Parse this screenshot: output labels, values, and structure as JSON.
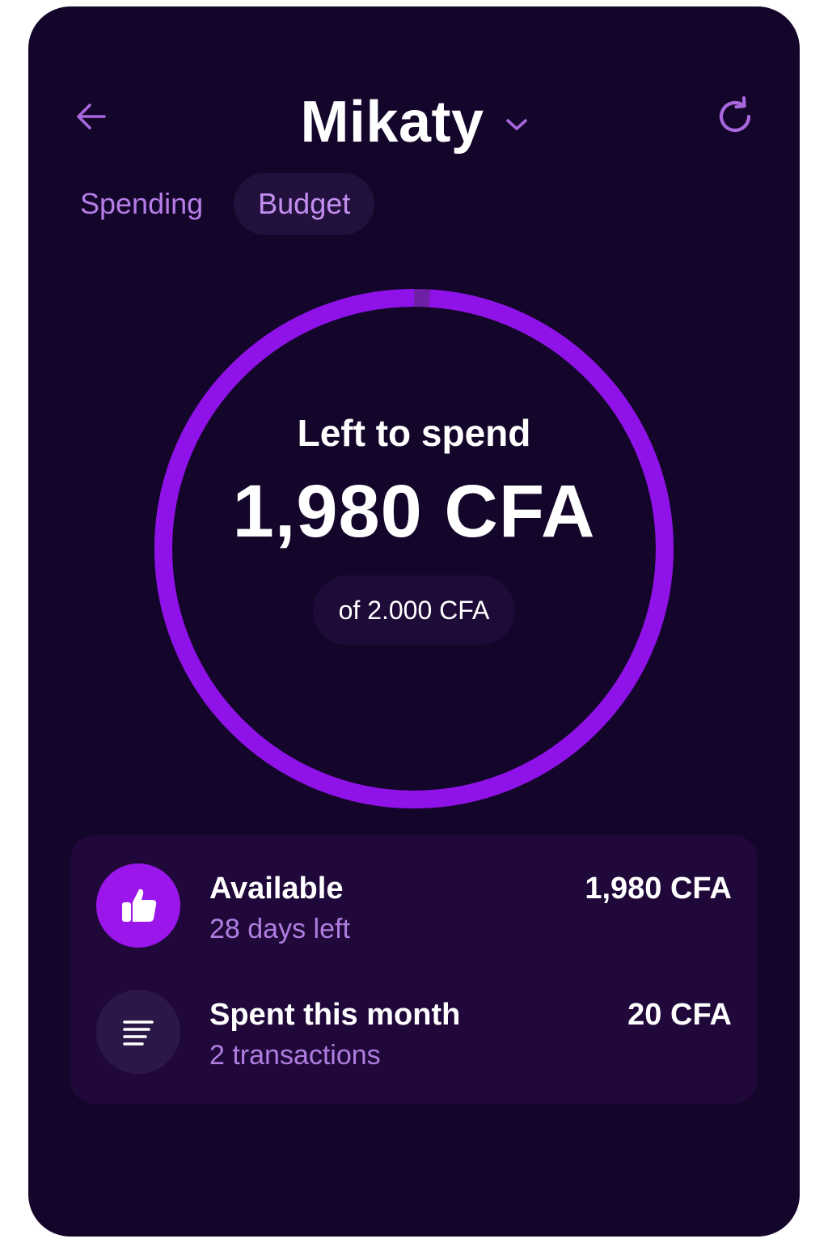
{
  "header": {
    "title": "Mikaty",
    "back_icon": "arrow-left-icon",
    "dropdown_icon": "chevron-down-icon",
    "refresh_icon": "refresh-icon"
  },
  "tabs": [
    {
      "label": "Spending",
      "active": false
    },
    {
      "label": "Budget",
      "active": true
    }
  ],
  "budget_ring": {
    "label": "Left to spend",
    "amount": "1,980 CFA",
    "total": "of 2.000 CFA",
    "fraction_spent": 0.01
  },
  "summary": [
    {
      "title": "Available",
      "subtitle": "28 days left",
      "amount": "1,980 CFA",
      "icon": "thumbs-up-icon"
    },
    {
      "title": "Spent this month",
      "subtitle": "2 transactions",
      "amount": "20 CFA",
      "icon": "list-icon"
    }
  ],
  "colors": {
    "background": "#14052a",
    "accent": "#9b16ea",
    "accent_text": "#b57de6",
    "card": "#20093a"
  }
}
